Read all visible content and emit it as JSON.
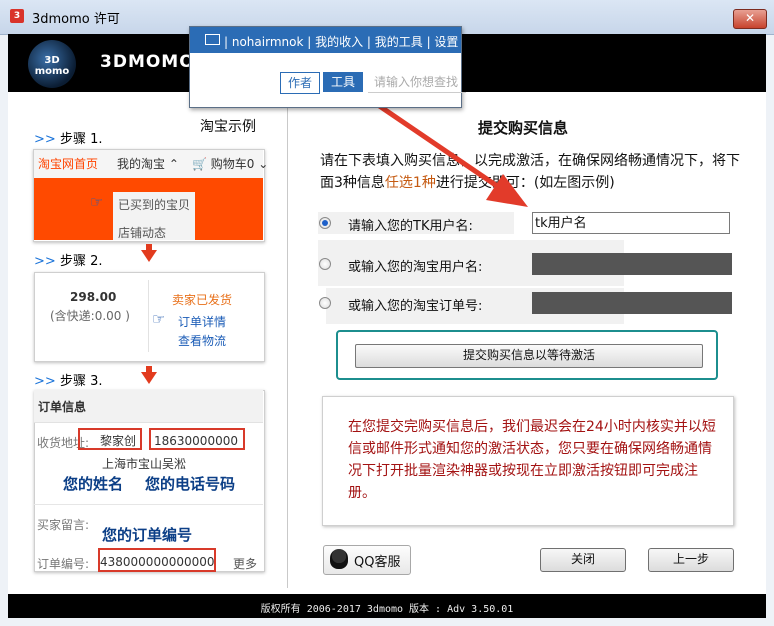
{
  "window": {
    "title": "3dmomo 许可",
    "close_glyph": "✕",
    "app_icon_text": "3"
  },
  "banner": {
    "brand": "3DMOMO",
    "logo_text": "3D momo"
  },
  "popup": {
    "menu_text": "| nohairmnok | 我的收入 | 我的工具 | 设置",
    "btn_author": "作者",
    "btn_tool": "工具",
    "search_placeholder": "请输入你想查找"
  },
  "left": {
    "taobao_example": "淘宝示例",
    "step1": "步骤 1.",
    "step2": "步骤 2.",
    "step3": "步骤 3.",
    "step_arrows": ">>",
    "tb_home": "淘宝网首页",
    "tb_my": "我的淘宝 ⌃",
    "tb_cart": "购物车0 ⌄",
    "tb_cart_icon": "🛒",
    "tb_bought": "已买到的宝贝",
    "tb_shop": "店铺动态",
    "order_price": "298.00",
    "order_ship": "(含快递:0.00 )",
    "seller_sent": "卖家已发货",
    "order_detail": "订单详情",
    "view_logistics": "查看物流",
    "info_title": "订单信息",
    "addr_label": "收货地址:",
    "addr_name": "黎家创",
    "addr_phone": "18630000000",
    "addr_city": "上海市宝山吴淞",
    "note_name": "您的姓名",
    "note_phone": "您的电话号码",
    "msg_label": "买家留言:",
    "note_order": "您的订单编号",
    "order_no_label": "订单编号:",
    "order_no": "438000000000000",
    "more": "更多"
  },
  "right": {
    "title": "提交购买信息",
    "desc_1": "请在下表填入购买信息，以完成激活，在确保网络畅通情况下，将下面3种信息",
    "desc_hl": "任选1种",
    "desc_2": "进行提交即可：(如左图示例)",
    "opt_tk": "请输入您的TK用户名:",
    "tk_value": "tk用户名",
    "opt_taobao_user": "或输入您的淘宝用户名:",
    "opt_taobao_order": "或输入您的淘宝订单号:",
    "submit": "提交购买信息以等待激活",
    "notice": "在您提交完购买信息后，我们最迟会在24小时内核实并以短信或邮件形式通知您的激活状态，您只要在确保网络畅通情况下打开批量渲染神器或按现在立即激活按钮即可完成注册。",
    "qq": "QQ客服",
    "close": "关闭",
    "back": "上一步"
  },
  "footer": {
    "text": "版权所有 2006-2017  3dmomo  版本 :  Adv 3.50.01"
  },
  "colors": {
    "accent": "#2b6cb5",
    "taobao_orange": "#ff4a00",
    "notice_red": "#a31212",
    "teal": "#1c8e8e"
  },
  "icons": [
    "mail-icon",
    "hand-pointer-icon",
    "cart-icon",
    "down-arrow-icon",
    "qq-penguin-icon",
    "radio-icon"
  ]
}
